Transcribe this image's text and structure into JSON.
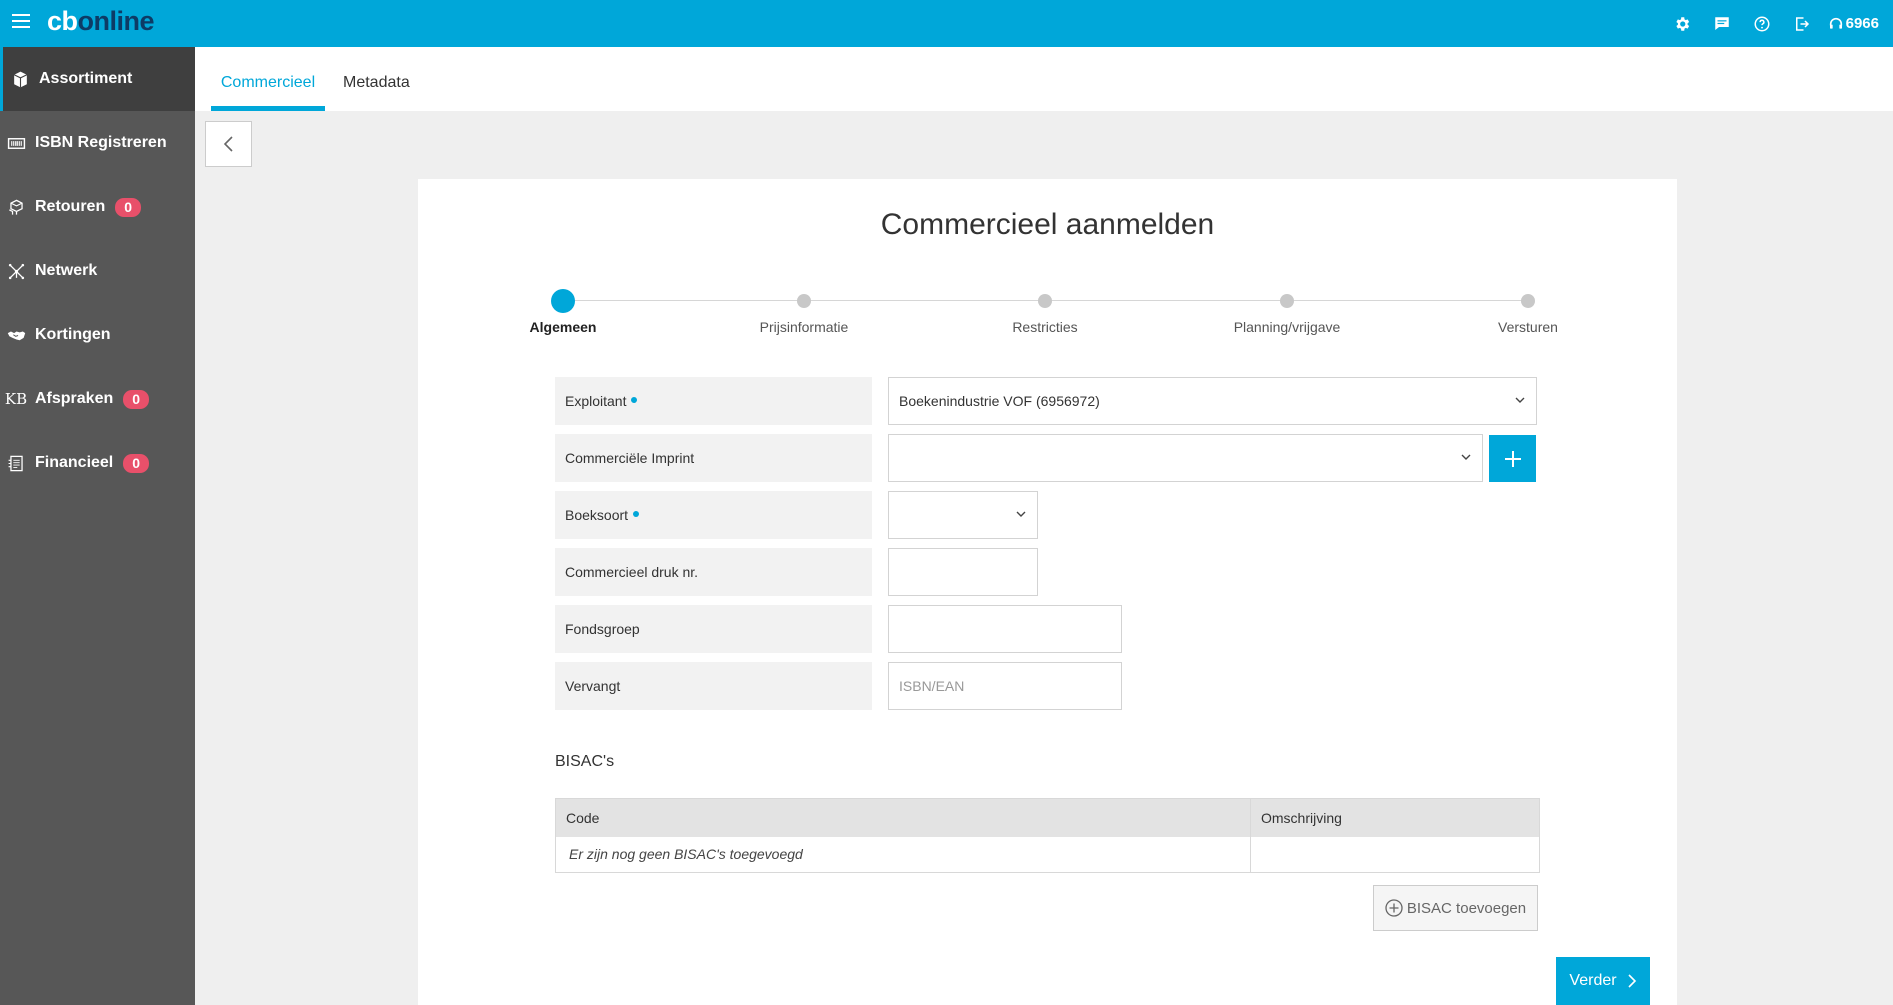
{
  "app": {
    "logo_part1": "cb",
    "logo_part2": "online",
    "support_number": "6966",
    "brand_color": "#00a7d9"
  },
  "header_icons": [
    "gear-icon",
    "chat-icon",
    "help-icon",
    "logout-icon",
    "headset-icon"
  ],
  "sidebar": {
    "items": [
      {
        "label": "Assortiment",
        "icon": "box-icon",
        "active": true
      },
      {
        "label": "ISBN Registreren",
        "icon": "barcode-icon"
      },
      {
        "label": "Retouren",
        "icon": "returns-icon",
        "badge": "0"
      },
      {
        "label": "Netwerk",
        "icon": "network-icon"
      },
      {
        "label": "Kortingen",
        "icon": "handshake-icon"
      },
      {
        "label": "Afspraken",
        "icon": "kb-icon",
        "badge": "0"
      },
      {
        "label": "Financieel",
        "icon": "invoice-icon",
        "badge": "0"
      }
    ]
  },
  "tabs": [
    {
      "label": "Commercieel",
      "active": true
    },
    {
      "label": "Metadata"
    }
  ],
  "page": {
    "title": "Commercieel aanmelden"
  },
  "stepper": {
    "steps": [
      {
        "label": "Algemeen",
        "active": true
      },
      {
        "label": "Prijsinformatie"
      },
      {
        "label": "Restricties"
      },
      {
        "label": "Planning/vrijgave"
      },
      {
        "label": "Versturen"
      }
    ]
  },
  "form": {
    "exploitant": {
      "label": "Exploitant",
      "value": "Boekenindustrie VOF (6956972)",
      "required": true
    },
    "imprint": {
      "label": "Commerciële Imprint",
      "value": ""
    },
    "boeksoort": {
      "label": "Boeksoort",
      "value": "",
      "required": true
    },
    "druk": {
      "label": "Commercieel druk nr.",
      "value": ""
    },
    "fondsgroep": {
      "label": "Fondsgroep",
      "value": ""
    },
    "vervangt": {
      "label": "Vervangt",
      "value": "",
      "placeholder": "ISBN/EAN"
    }
  },
  "bisac": {
    "title": "BISAC's",
    "columns": [
      "Code",
      "Omschrijving"
    ],
    "empty_text": "Er zijn nog geen BISAC's toegevoegd",
    "add_label": "BISAC toevoegen"
  },
  "buttons": {
    "next_label": "Verder"
  }
}
